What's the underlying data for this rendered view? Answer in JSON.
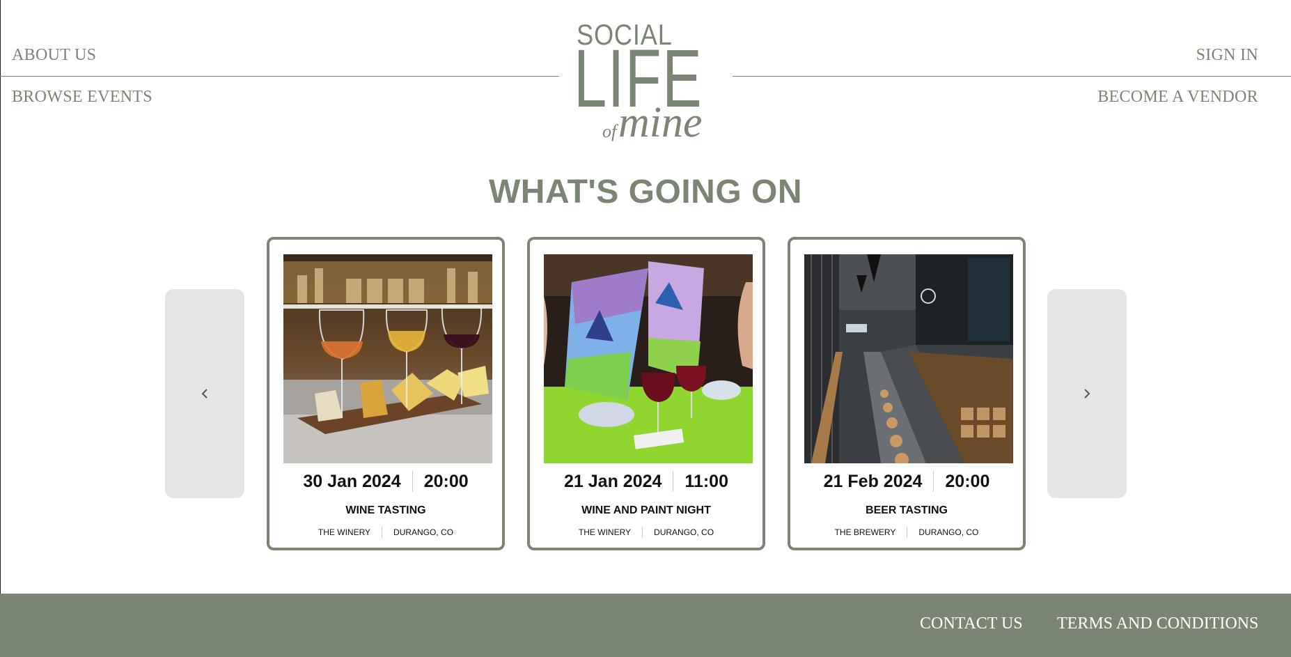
{
  "nav": {
    "about": "ABOUT US",
    "browse": "BROWSE EVENTS",
    "signin": "SIGN IN",
    "vendor": "BECOME A VENDOR"
  },
  "logo": {
    "line1": "SOCIAL",
    "line2": "LIFE",
    "line3a": "of",
    "line3b": "mine"
  },
  "section_title": "WHAT'S GOING ON",
  "carousel": {
    "prev_icon": "chevron-left-icon",
    "next_icon": "chevron-right-icon",
    "events": [
      {
        "date": "30 Jan 2024",
        "time": "20:00",
        "title": "WINE TASTING",
        "venue": "THE WINERY",
        "city": "DURANGO, CO",
        "image": "wine-glasses-cheese-photo"
      },
      {
        "date": "21 Jan 2024",
        "time": "11:00",
        "title": "WINE AND PAINT NIGHT",
        "venue": "THE WINERY",
        "city": "DURANGO, CO",
        "image": "painting-canvases-photo"
      },
      {
        "date": "21 Feb 2024",
        "time": "20:00",
        "title": "BEER TASTING",
        "venue": "THE BREWERY",
        "city": "DURANGO, CO",
        "image": "brewery-bar-interior-photo"
      }
    ]
  },
  "footer": {
    "contact": "CONTACT US",
    "terms": "TERMS AND CONDITIONS"
  },
  "colors": {
    "brand": "#7a8574",
    "arrow_bg": "#e5e5e5"
  }
}
